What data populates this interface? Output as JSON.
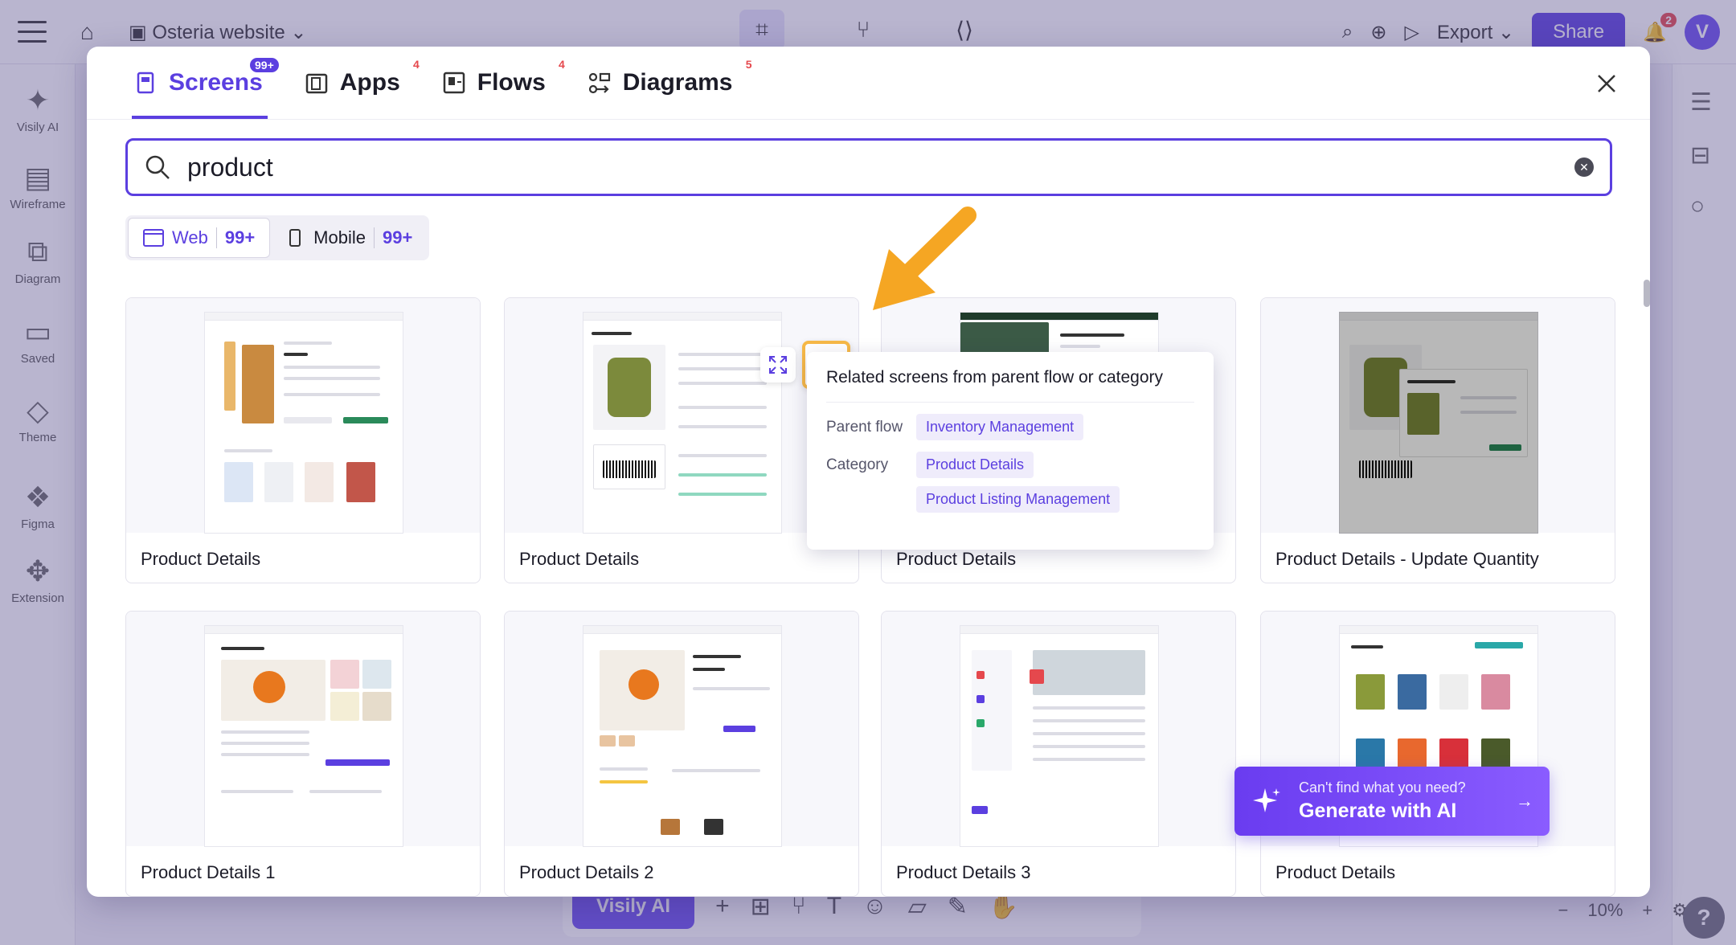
{
  "app": {
    "breadcrumb": "Osteria website",
    "export_label": "Export",
    "share_label": "Share",
    "notifications": "2",
    "avatar": "V",
    "left_nav": [
      "Visily AI",
      "Wireframe",
      "Diagram",
      "Saved",
      "Theme",
      "Figma",
      "Extension"
    ],
    "bottom_ai": "Visily AI",
    "zoom": "10%",
    "help": "?"
  },
  "modal": {
    "tabs": [
      {
        "label": "Screens",
        "badge": "99+",
        "icon": "screen-icon"
      },
      {
        "label": "Apps",
        "badge": "4",
        "icon": "apps-icon"
      },
      {
        "label": "Flows",
        "badge": "4",
        "icon": "flows-icon"
      },
      {
        "label": "Diagrams",
        "badge": "5",
        "icon": "diagram-icon"
      }
    ],
    "search": {
      "value": "product"
    },
    "platforms": [
      {
        "label": "Web",
        "count": "99+"
      },
      {
        "label": "Mobile",
        "count": "99+"
      }
    ],
    "cards": [
      "Product Details",
      "Product Details",
      "Product Details",
      "Product Details - Update Quantity",
      "Product Details 1",
      "Product Details 2",
      "Product Details 3",
      "Product Details"
    ],
    "popover": {
      "heading": "Related screens from parent flow or category",
      "parent_flow_label": "Parent flow",
      "parent_flow": "Inventory Management",
      "category_label": "Category",
      "categories": [
        "Product Details",
        "Product Listing Management"
      ]
    },
    "gen_ai": {
      "subtitle": "Can't find what you need?",
      "title": "Generate with AI"
    }
  },
  "colors": {
    "accent": "#5b3fe0",
    "highlight": "#f7b947",
    "badge": "#e5484d"
  }
}
